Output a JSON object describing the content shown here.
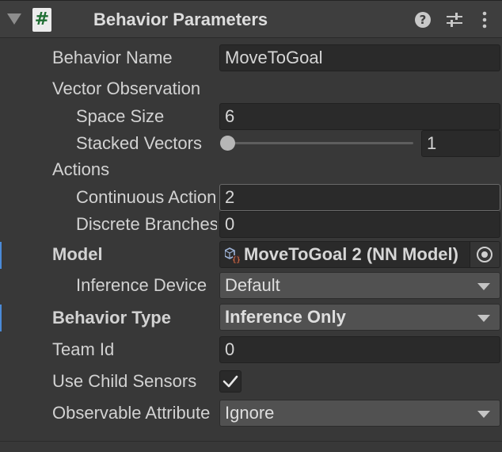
{
  "header": {
    "title": "Behavior Parameters",
    "script_icon_glyph": "#",
    "icons": [
      "foldout-arrow-icon",
      "script-icon",
      "help-icon",
      "presets-icon",
      "kebab-menu-icon"
    ]
  },
  "fields": {
    "behavior_name": {
      "label": "Behavior Name",
      "value": "MoveToGoal"
    },
    "vector_observation": {
      "label": "Vector Observation"
    },
    "space_size": {
      "label": "Space Size",
      "value": "6"
    },
    "stacked_vectors": {
      "label": "Stacked Vectors",
      "value": "1",
      "slider_fraction": 0.0
    },
    "actions": {
      "label": "Actions"
    },
    "continuous_actions": {
      "label": "Continuous Actions",
      "value": "2"
    },
    "discrete_branches": {
      "label": "Discrete Branches",
      "value": "0"
    },
    "model": {
      "label": "Model",
      "value": "MoveToGoal 2 (NN Model)"
    },
    "inference_device": {
      "label": "Inference Device",
      "value": "Default"
    },
    "behavior_type": {
      "label": "Behavior Type",
      "value": "Inference Only"
    },
    "team_id": {
      "label": "Team Id",
      "value": "0"
    },
    "use_child_sensors": {
      "label": "Use Child Sensors",
      "checked": true
    },
    "observable_attribute": {
      "label": "Observable Attribute Handling",
      "value": "Ignore"
    }
  },
  "colors": {
    "panel_bg": "#383838",
    "field_bg": "#2a2a2a",
    "dropdown_bg": "#515151",
    "accent_marker": "#4b8bd8"
  }
}
